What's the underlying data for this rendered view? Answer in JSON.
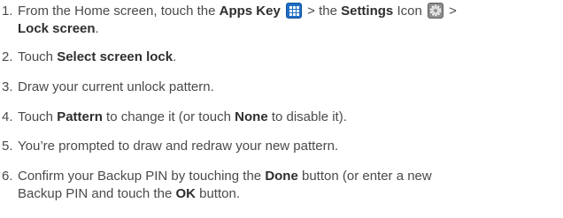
{
  "steps": [
    {
      "number": "1.",
      "part1": "From the Home screen, touch the ",
      "apps_key": "Apps Key",
      "part2": " > the ",
      "settings": "Settings",
      "part3": " Icon ",
      "part4": " >",
      "lock_screen": "Lock screen",
      "part5": "."
    },
    {
      "number": "2.",
      "part1": "Touch ",
      "select_screen_lock": "Select screen lock",
      "part2": "."
    },
    {
      "number": "3.",
      "text": "Draw your current unlock pattern."
    },
    {
      "number": "4.",
      "part1": "Touch ",
      "pattern": "Pattern",
      "part2": " to change it (or touch ",
      "none": "None",
      "part3": " to disable it)."
    },
    {
      "number": "5.",
      "text": "You’re prompted to draw and redraw your new pattern."
    },
    {
      "number": "6.",
      "part1": "Confirm your Backup PIN by touching the ",
      "done": "Done",
      "part2": " button (or enter a new",
      "part3": "Backup PIN and touch the ",
      "ok": "OK",
      "part4": " button."
    }
  ],
  "icons": {
    "apps_key_icon": "apps-grid-icon",
    "settings_icon": "gear-icon",
    "apps_color": "#1f6fc4",
    "settings_color": "#8e8e8e"
  }
}
